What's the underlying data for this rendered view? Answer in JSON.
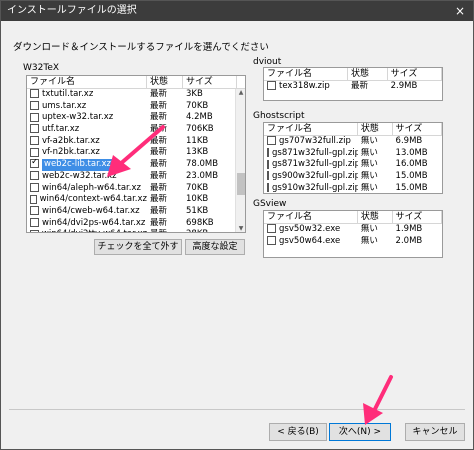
{
  "window": {
    "title": "インストールファイルの選択",
    "close": "×"
  },
  "instruction": "ダウンロード＆インストールするファイルを選んでください",
  "w32tex": {
    "label": "W32TeX",
    "columns": [
      "ファイル名",
      "状態",
      "サイズ"
    ],
    "rows": [
      {
        "name": "txtutil.tar.xz",
        "status": "最新",
        "size": "3KB",
        "checked": false
      },
      {
        "name": "ums.tar.xz",
        "status": "最新",
        "size": "70KB",
        "checked": false
      },
      {
        "name": "uptex-w32.tar.xz",
        "status": "最新",
        "size": "4.2MB",
        "checked": false
      },
      {
        "name": "utf.tar.xz",
        "status": "最新",
        "size": "706KB",
        "checked": false
      },
      {
        "name": "vf-a2bk.tar.xz",
        "status": "最新",
        "size": "11KB",
        "checked": false
      },
      {
        "name": "vf-n2bk.tar.xz",
        "status": "最新",
        "size": "13KB",
        "checked": false
      },
      {
        "name": "web2c-lib.tar.xz",
        "status": "最新",
        "size": "78.0MB",
        "checked": true,
        "selected": true
      },
      {
        "name": "web2c-w32.tar.xz",
        "status": "最新",
        "size": "23.0MB",
        "checked": false
      },
      {
        "name": "win64/aleph-w64.tar.xz",
        "status": "最新",
        "size": "70KB",
        "checked": false
      },
      {
        "name": "win64/context-w64.tar.xz",
        "status": "最新",
        "size": "10KB",
        "checked": false
      },
      {
        "name": "win64/cweb-w64.tar.xz",
        "status": "最新",
        "size": "51KB",
        "checked": false
      },
      {
        "name": "win64/dvi2ps-w64.tar.xz",
        "status": "最新",
        "size": "698KB",
        "checked": false
      },
      {
        "name": "win64/dvi2tty-w64.tar.xz",
        "status": "最新",
        "size": "28KB",
        "checked": false
      },
      {
        "name": "win64/dvipdfm-w64.tar.xz",
        "status": "最新",
        "size": "764KB",
        "checked": false
      }
    ],
    "check_all": "チェックを全て外す",
    "advanced": "高度な設定"
  },
  "dviout": {
    "label": "dviout",
    "columns": [
      "ファイル名",
      "状態",
      "サイズ"
    ],
    "rows": [
      {
        "name": "tex318w.zip",
        "status": "最新",
        "size": "2.9MB",
        "checked": false
      }
    ]
  },
  "ghostscript": {
    "label": "Ghostscript",
    "columns": [
      "ファイル名",
      "状態",
      "サイズ"
    ],
    "rows": [
      {
        "name": "gs707w32full.zip",
        "status": "無い",
        "size": "6.9MB",
        "checked": false
      },
      {
        "name": "gs871w32full-gpl.zip",
        "status": "無い",
        "size": "13.0MB",
        "checked": false
      },
      {
        "name": "gs871w32full-gpl.zip",
        "status": "無い",
        "size": "16.0MB",
        "checked": false
      },
      {
        "name": "gs900w32full-gpl.zip",
        "status": "無い",
        "size": "15.0MB",
        "checked": false
      },
      {
        "name": "gs910w32full-gpl.zip",
        "status": "無い",
        "size": "15.0MB",
        "checked": false
      }
    ]
  },
  "gsview": {
    "label": "GSview",
    "columns": [
      "ファイル名",
      "状態",
      "サイズ"
    ],
    "rows": [
      {
        "name": "gsv50w32.exe",
        "status": "無い",
        "size": "1.9MB",
        "checked": false
      },
      {
        "name": "gsv50w64.exe",
        "status": "無い",
        "size": "2.0MB",
        "checked": false
      }
    ]
  },
  "footer": {
    "back": "< 戻る(B)",
    "next": "次へ(N) >",
    "cancel": "キャンセル"
  },
  "colors": {
    "annotation": "#ff2d7a",
    "selection": "#3e8ee6"
  }
}
